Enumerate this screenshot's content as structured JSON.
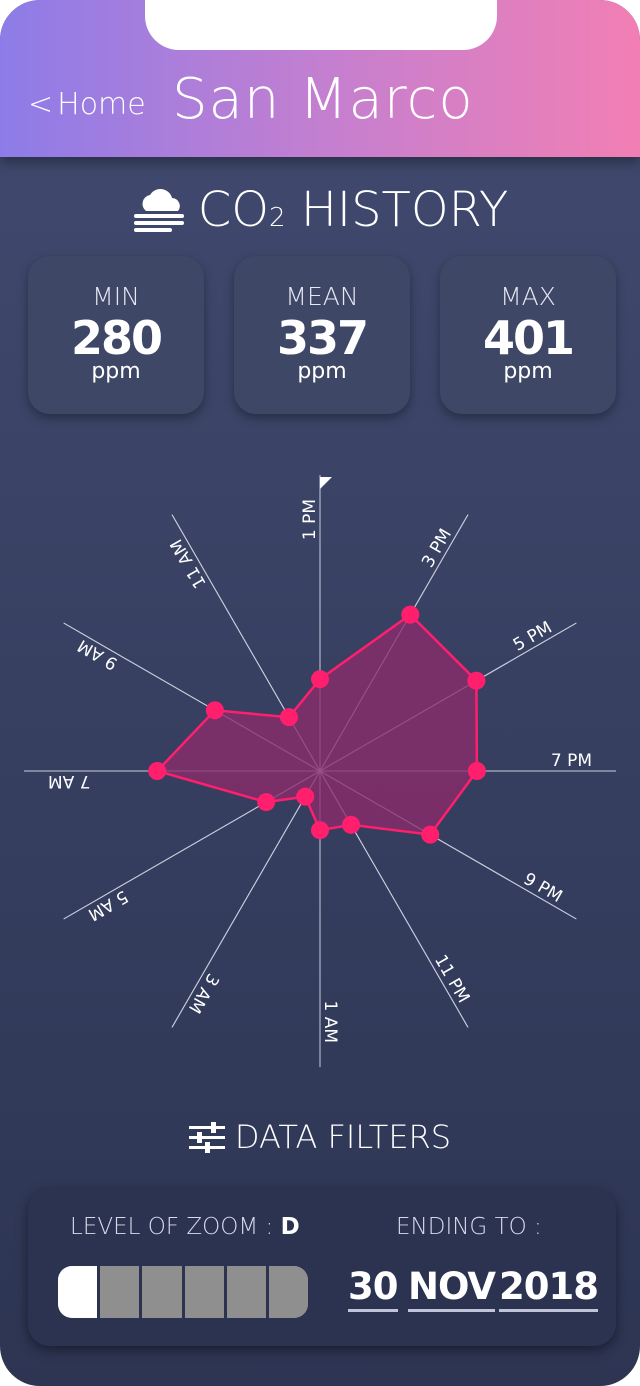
{
  "header": {
    "back_chevron": "<",
    "back_label": "Home",
    "station_name": "San Marco"
  },
  "history": {
    "title_prefix": "CO",
    "title_sub": "2",
    "title_suffix": " HISTORY",
    "icon": "cloud-fog-icon"
  },
  "stats": {
    "min": {
      "label": "MIN",
      "value": "280",
      "unit": "ppm"
    },
    "mean": {
      "label": "MEAN",
      "value": "337",
      "unit": "ppm"
    },
    "max": {
      "label": "MAX",
      "value": "401",
      "unit": "ppm"
    }
  },
  "chart_data": {
    "type": "radar",
    "axes": [
      "1 PM",
      "3 PM",
      "5 PM",
      "7 PM",
      "9 PM",
      "11 PM",
      "1 AM",
      "3 AM",
      "5 AM",
      "7 AM",
      "9 AM",
      "11 AM"
    ],
    "series": [
      {
        "values": [
          0.31,
          0.61,
          0.61,
          0.53,
          0.43,
          0.21,
          0.2,
          0.1,
          0.21,
          0.55,
          0.41,
          0.21
        ]
      }
    ],
    "radial_range": [
      0,
      1
    ],
    "colors": {
      "fill": "#8c2a6a",
      "stroke": "#ff1f6d",
      "point": "#ff1f6d",
      "axis": "#c9ccdc"
    }
  },
  "filters": {
    "title": "DATA FILTERS",
    "icon": "sliders-icon",
    "zoom_label": "LEVEL OF ZOOM :",
    "zoom_level": "D",
    "zoom_segments": 6,
    "zoom_active": 1,
    "ending_label": "ENDING TO :",
    "day": "30",
    "month": "NOV",
    "year": "2018"
  }
}
